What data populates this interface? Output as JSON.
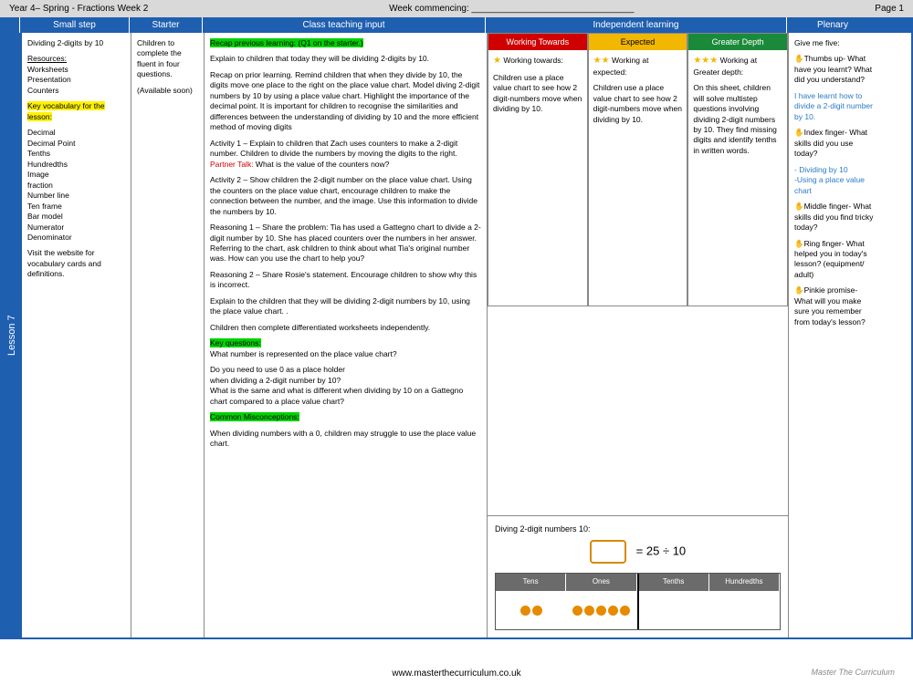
{
  "top": {
    "left": "Year 4– Spring - Fractions Week 2",
    "mid": "Week commencing: ________________________________",
    "right": "Page 1"
  },
  "headers": {
    "smallstep": "Small step",
    "starter": "Starter",
    "teaching": "Class teaching input",
    "independent": "Independent learning",
    "plenary": "Plenary"
  },
  "lesson_label": "Lesson 7",
  "smallstep": {
    "title": "Dividing 2-digits by 10",
    "resources_label": "Resources:",
    "resources": "Worksheets\nPresentation\nCounters",
    "vocab_label": "Key vocabulary for the lesson:",
    "vocab": "Decimal\nDecimal Point\nTenths\nHundredths\nImage\nfraction\nNumber line\nTen frame\nBar model\nNumerator\nDenominator",
    "visit": "Visit the website for vocabulary cards and definitions."
  },
  "starter": {
    "p1": "Children to complete the fluent in four questions.",
    "p2": "(Available soon)"
  },
  "teaching": {
    "recap_hl": "Recap previous learning: (Q1 on the starter.)",
    "p1": "Explain to children that today they will be dividing 2-digits by 10.",
    "p2": "Recap on prior learning. Remind children that when they divide by 10, the digits move one place to the right on the place value chart. Model diving 2-digit numbers by 10 by using a place value chart. Highlight the importance of the decimal point. It is important for children to recognise the similarities and differences between the understanding of dividing by 10 and the more efficient method of moving digits",
    "p3a": "Activity 1 – Explain to children that Zach uses counters to make a 2-digit number.  Children to divide the numbers by moving the digits to the right. ",
    "p3b_red": "Partner Talk:",
    "p3c": " What is the value of the counters now?",
    "p4": "Activity 2 – Show children the 2-digit number on the place value chart. Using the counters on the place value chart, encourage children to make the connection between the number, and the image. Use this information  to divide the numbers by 10.",
    "p5": "Reasoning 1 – Share the problem: Tia has used a Gattegno chart to divide a 2-digit number by 10. She has placed counters over the numbers in her answer.\nReferring to the chart, ask children to think about what  Tia's original number was. How can you use the chart to help you?",
    "p6": "Reasoning 2 – Share Rosie's statement. Encourage children to show why this is incorrect.",
    "p7": "Explain to the children that they will be dividing 2-digit numbers by 10, using the place value chart. .",
    "p8": "Children then complete differentiated worksheets independently.",
    "kq_hl": "Key questions:",
    "kq1": "What number is represented on the place value chart?",
    "kq2": "Do you need to use 0 as a place holder\nwhen dividing a 2-digit number by 10?\nWhat is the same and what is different when dividing by 10 on a Gattegno chart compared to a place value chart?",
    "cm_hl": "Common Misconceptions:",
    "cm1": "When dividing numbers with a 0, children may struggle to use the place value chart."
  },
  "diff": {
    "wt_head": "Working Towards",
    "ex_head": "Expected",
    "gd_head": "Greater Depth",
    "wt_label": " Working towards:",
    "ex_label": " Working at expected:",
    "gd_label": " Working at Greater depth:",
    "wt_body": "Children use a place value chart to see how 2 digit-numbers move when dividing by 10.",
    "ex_body": "Children use a place value chart to see how 2 digit-numbers move when dividing by 10.",
    "gd_body": "On this sheet, children will solve multistep questions involving dividing 2-digit numbers by 10. They find missing digits and identify tenths in written words."
  },
  "diagram": {
    "title": "Diving 2-digit numbers 10:",
    "eq": "= 25 ÷ 10",
    "h1": "Tens",
    "h2": "Ones",
    "h3": "Tenths",
    "h4": "Hundredths"
  },
  "plenary": {
    "intro": "Give me five:",
    "thumb": "✋Thumbs up- What have you learnt? What did you understand?",
    "thumb_ans": "I have learnt how to divide a 2-digit number by 10.",
    "index": "✋Index finger- What skills did you use today?",
    "index_ans": "- Dividing by 10\n-Using a place value chart",
    "middle": "✋Middle finger- What skills did you find tricky today?",
    "ring": "✋Ring finger- What helped you in today's lesson? (equipment/ adult)",
    "pinkie": "✋Pinkie promise- What will you make sure you remember from today's lesson?"
  },
  "footer_url": "www.masterthecurriculum.co.uk",
  "logo_text": "Master The Curriculum"
}
